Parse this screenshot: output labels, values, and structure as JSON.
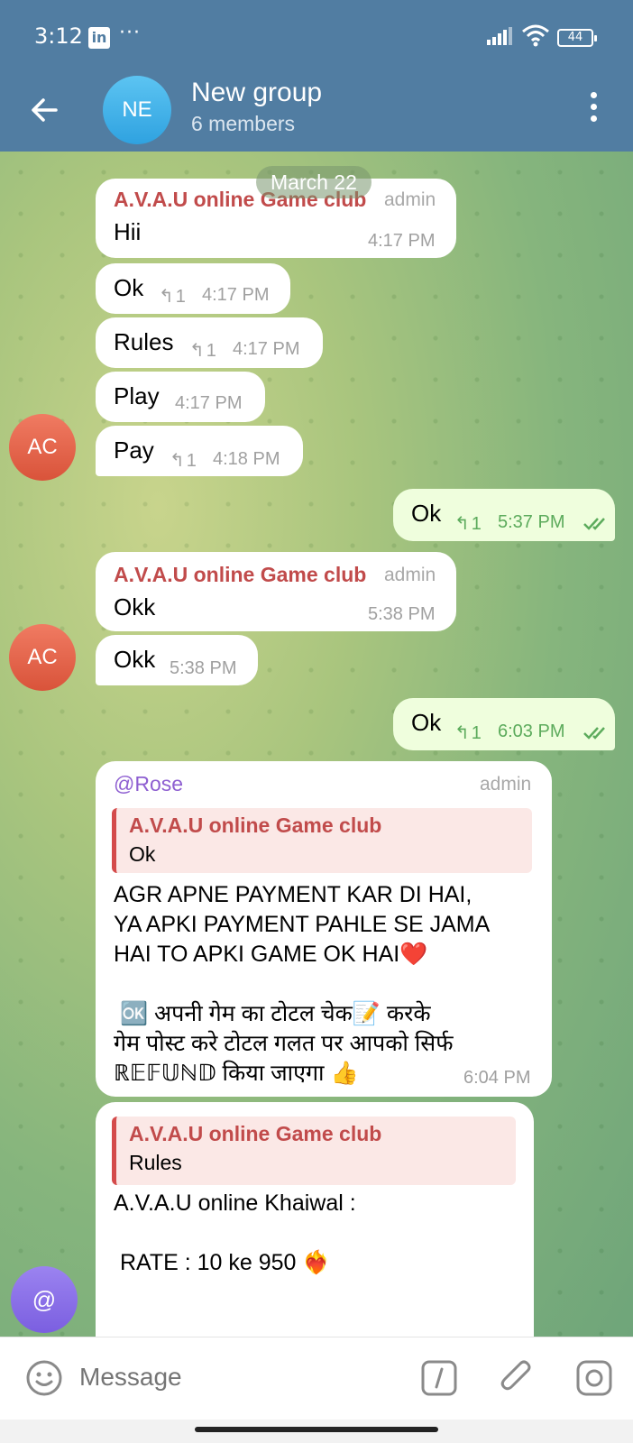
{
  "status": {
    "time": "3:12",
    "app_badge": "in",
    "dots": "···",
    "battery": "44"
  },
  "header": {
    "avatar_initials": "NE",
    "title": "New group",
    "subtitle": "6 members"
  },
  "chat": {
    "date": "March 22",
    "messages": [
      {
        "sender": "A.V.A.U online Game club",
        "role": "admin",
        "text": "Hii",
        "time": "4:17 PM"
      },
      {
        "text": "Ok",
        "replies": "1",
        "time": "4:17 PM"
      },
      {
        "text": "Rules",
        "replies": "1",
        "time": "4:17 PM"
      },
      {
        "text": "Play",
        "time": "4:17 PM"
      },
      {
        "text": "Pay",
        "replies": "1",
        "time": "4:18 PM",
        "avatar": "AC"
      },
      {
        "text": "Ok",
        "replies": "1",
        "time": "5:37 PM",
        "outgoing": true
      },
      {
        "sender": "A.V.A.U online Game club",
        "role": "admin",
        "text": "Okk",
        "time": "5:38 PM"
      },
      {
        "text": "Okk",
        "time": "5:38 PM",
        "avatar": "AC"
      },
      {
        "text": "Ok",
        "replies": "1",
        "time": "6:03 PM",
        "outgoing": true
      },
      {
        "sender": "@Rose",
        "role": "admin",
        "quote_sender": "A.V.A.U online Game club",
        "quote_text": "Ok",
        "text": "AGR APNE PAYMENT KAR DI HAI,\nYA APKI PAYMENT PAHLE SE JAMA\nHAI TO APKI GAME OK HAI❤️\n\n 🆗 अपनी गेम का टोटल चेक📝 करके\nगेम पोस्ट करे टोटल गलत पर आपको सिर्फ\nℝ𝔼𝔽𝕌ℕ𝔻 किया जाएगा 👍",
        "time": "6:04 PM"
      },
      {
        "quote_sender": "A.V.A.U online Game club",
        "quote_text": "Rules",
        "text": "A.V.A.U online Khaiwal :\n\n RATE : 10 ke 950 ❤️‍🔥"
      }
    ]
  },
  "mention_button": "@",
  "input": {
    "placeholder": "Message"
  },
  "colors": {
    "header": "#517da2",
    "outgoing_bubble": "#effedd",
    "sender_name": "#c14b4b",
    "mention_name": "#8e5fd1"
  }
}
